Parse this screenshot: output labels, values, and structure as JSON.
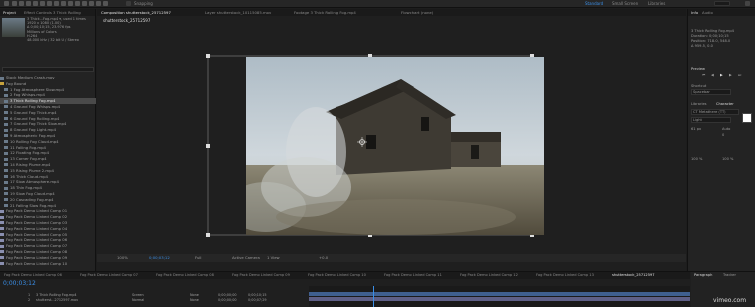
{
  "toolbar": {
    "snapping": "Snapping",
    "workspaces": [
      "Standard",
      "Small Screen",
      "Libraries"
    ],
    "active_workspace": "Standard"
  },
  "project": {
    "tabs": [
      "Project",
      "Effect Controls 3 Thick Rolling"
    ],
    "thumb_info": [
      "3 Thick...Fog.mp4 ▾, used 1 times",
      "1920 x 1080 (1.00)",
      "Δ 0;00;10;15, 23.976 fps",
      "Millions of Colors",
      "H.264",
      "48.000 kHz / 32 bit U / Stereo"
    ],
    "files": [
      {
        "name": "Stock Medium Crash.mov",
        "type": "file",
        "sel": false
      },
      {
        "name": "Fog Bound",
        "type": "folder",
        "sel": false
      },
      {
        "name": "1 Fog Atmosphere Slow.mp4",
        "type": "file",
        "sel": false
      },
      {
        "name": "2 Fog Whisps.mp4",
        "type": "file",
        "sel": false
      },
      {
        "name": "3 Thick Rolling Fog.mp4",
        "type": "file",
        "sel": true
      },
      {
        "name": "4 Ground Fog Whisps.mp4",
        "type": "file",
        "sel": false
      },
      {
        "name": "5 Ground Fog Thick.mp4",
        "type": "file",
        "sel": false
      },
      {
        "name": "6 Ground Fog Rolling.mp4",
        "type": "file",
        "sel": false
      },
      {
        "name": "7 Ground Fog Thick Slow.mp4",
        "type": "file",
        "sel": false
      },
      {
        "name": "8 Ground Fog Light.mp4",
        "type": "file",
        "sel": false
      },
      {
        "name": "9 Atmospheric Fog.mp4",
        "type": "file",
        "sel": false
      },
      {
        "name": "10 Rolling Fog Cloud.mp4",
        "type": "file",
        "sel": false
      },
      {
        "name": "11 Falling Fog.mp4",
        "type": "file",
        "sel": false
      },
      {
        "name": "12 Floating Fog.mp4",
        "type": "file",
        "sel": false
      },
      {
        "name": "13 Corner Fog.mp4",
        "type": "file",
        "sel": false
      },
      {
        "name": "14 Rising Plume.mp4",
        "type": "file",
        "sel": false
      },
      {
        "name": "15 Rising Plume 2.mp4",
        "type": "file",
        "sel": false
      },
      {
        "name": "16 Thick Cloud.mp4",
        "type": "file",
        "sel": false
      },
      {
        "name": "17 Slow Atmosphere.mp4",
        "type": "file",
        "sel": false
      },
      {
        "name": "18 Thin Fog.mp4",
        "type": "file",
        "sel": false
      },
      {
        "name": "19 Slow Fog Cloud.mp4",
        "type": "file",
        "sel": false
      },
      {
        "name": "20 Cascading Fog.mp4",
        "type": "file",
        "sel": false
      },
      {
        "name": "21 Falling Slow Fog.mp4",
        "type": "file",
        "sel": false
      },
      {
        "name": "Fog Pack Demo Linked Comp 01",
        "type": "comp",
        "sel": false
      },
      {
        "name": "Fog Pack Demo Linked Comp 02",
        "type": "comp",
        "sel": false
      },
      {
        "name": "Fog Pack Demo Linked Comp 03",
        "type": "comp",
        "sel": false
      },
      {
        "name": "Fog Pack Demo Linked Comp 04",
        "type": "comp",
        "sel": false
      },
      {
        "name": "Fog Pack Demo Linked Comp 05",
        "type": "comp",
        "sel": false
      },
      {
        "name": "Fog Pack Demo Linked Comp 06",
        "type": "comp",
        "sel": false
      },
      {
        "name": "Fog Pack Demo Linked Comp 07",
        "type": "comp",
        "sel": false
      },
      {
        "name": "Fog Pack Demo Linked Comp 08",
        "type": "comp",
        "sel": false
      },
      {
        "name": "Fog Pack Demo Linked Comp 09",
        "type": "comp",
        "sel": false
      },
      {
        "name": "Fog Pack Demo Linked Comp 10",
        "type": "comp",
        "sel": false
      }
    ]
  },
  "viewer": {
    "tabs": [
      "Composition shutterstock_25712597",
      "Layer shutterstock_10115085.mov",
      "Footage 3 Thick Rolling Fog.mp4",
      "Flowchart (none)"
    ],
    "subtab": "shutterstock_25712597",
    "zoom": "100%",
    "timecode": "0;00;03;12",
    "resolution": "Full",
    "camera": "Active Camera",
    "views": "1 View",
    "exposure": "+0.0"
  },
  "right_panel": {
    "tabs": [
      "Info",
      "Audio"
    ],
    "info_lines": [
      "3 Thick Rolling Fog.mp4",
      "Duration: 0;00;10;15",
      "Position: 718.0, 548.0",
      "Δ 959.5, 0.0"
    ],
    "preview_label": "Preview",
    "shortcut_label": "Shortcut",
    "shortcut_value": "Spacebar",
    "libraries_label": "Libraries",
    "character_label": "Character",
    "font_name": "CT Metathere (TT)",
    "font_style": "Light",
    "font_size": "61 px",
    "leading": "Auto",
    "tracking": "0",
    "scale_v": "100 %",
    "scale_h": "100 %"
  },
  "timeline": {
    "tabs": [
      "Fog Pack Demo Linked Comp 06",
      "Fog Pack Demo Linked Comp 07",
      "Fog Pack Demo Linked Comp 08",
      "Fog Pack Demo Linked Comp 09",
      "Fog Pack Demo Linked Comp 10",
      "Fog Pack Demo Linked Comp 11",
      "Fog Pack Demo Linked Comp 12",
      "Fog Pack Demo Linked Comp 13",
      "shutterstock_25712597"
    ],
    "timecode": "0;00;03;12",
    "rows": [
      {
        "num": "1",
        "name": "3 Thick Rolling Fog.mp4",
        "mode": "Screen",
        "parent": "None",
        "in": "0;00;00;00",
        "dur": "0;00;10;15"
      },
      {
        "num": "2",
        "name": "shutterst...2712597.mov",
        "mode": "Normal",
        "parent": "None",
        "in": "0;00;00;00",
        "dur": "0;00;07;29"
      }
    ],
    "paragraph": "Paragraph",
    "tracker": "Tracker",
    "watermark": "vimeo.com"
  }
}
